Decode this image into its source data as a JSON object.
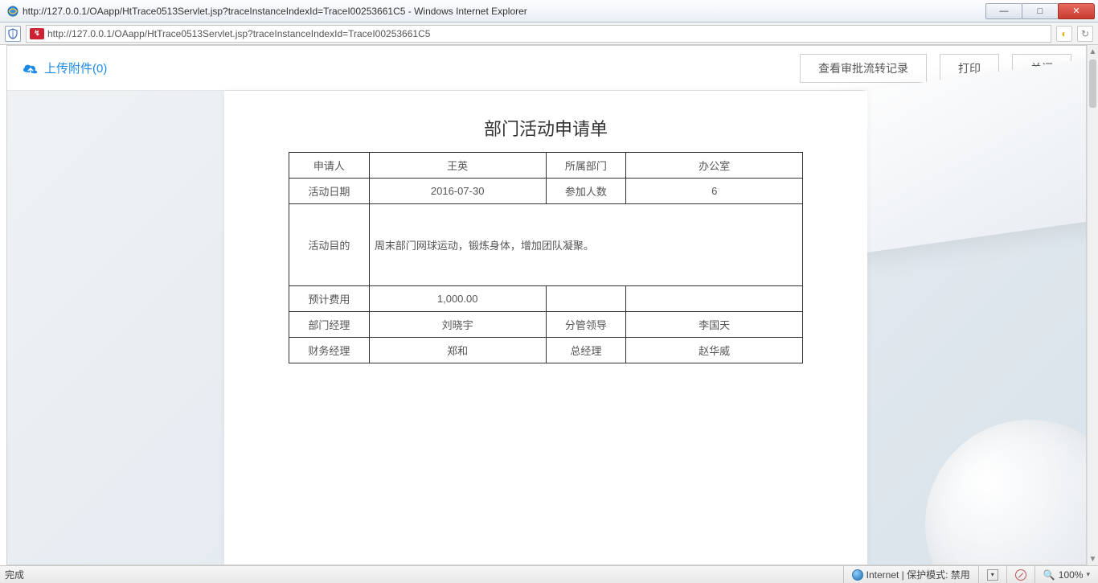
{
  "window": {
    "title": "http://127.0.0.1/OAapp/HtTrace0513Servlet.jsp?traceInstanceIndexId=TraceI00253661C5 - Windows Internet Explorer"
  },
  "address": {
    "url": "http://127.0.0.1/OAapp/HtTrace0513Servlet.jsp?traceInstanceIndexId=TraceI00253661C5"
  },
  "toolbar": {
    "attach_label": "上传附件(0)",
    "view_history": "查看审批流转记录",
    "print": "打印",
    "close": "关闭"
  },
  "form": {
    "title": "部门活动申请单",
    "rows": {
      "applicant_label": "申请人",
      "applicant_value": "王英",
      "dept_label": "所属部门",
      "dept_value": "办公室",
      "date_label": "活动日期",
      "date_value": "2016-07-30",
      "count_label": "参加人数",
      "count_value": "6",
      "purpose_label": "活动目的",
      "purpose_value": "周末部门网球运动，锻炼身体，增加团队凝聚。",
      "cost_label": "预计费用",
      "cost_value": "1,000.00",
      "dept_mgr_label": "部门经理",
      "dept_mgr_value": "刘晓宇",
      "vp_label": "分管领导",
      "vp_value": "李国天",
      "fin_mgr_label": "财务经理",
      "fin_mgr_value": "郑和",
      "gm_label": "总经理",
      "gm_value": "赵华威"
    }
  },
  "status": {
    "left": "完成",
    "zone": "Internet | 保护模式: 禁用",
    "zoom": "100%"
  }
}
